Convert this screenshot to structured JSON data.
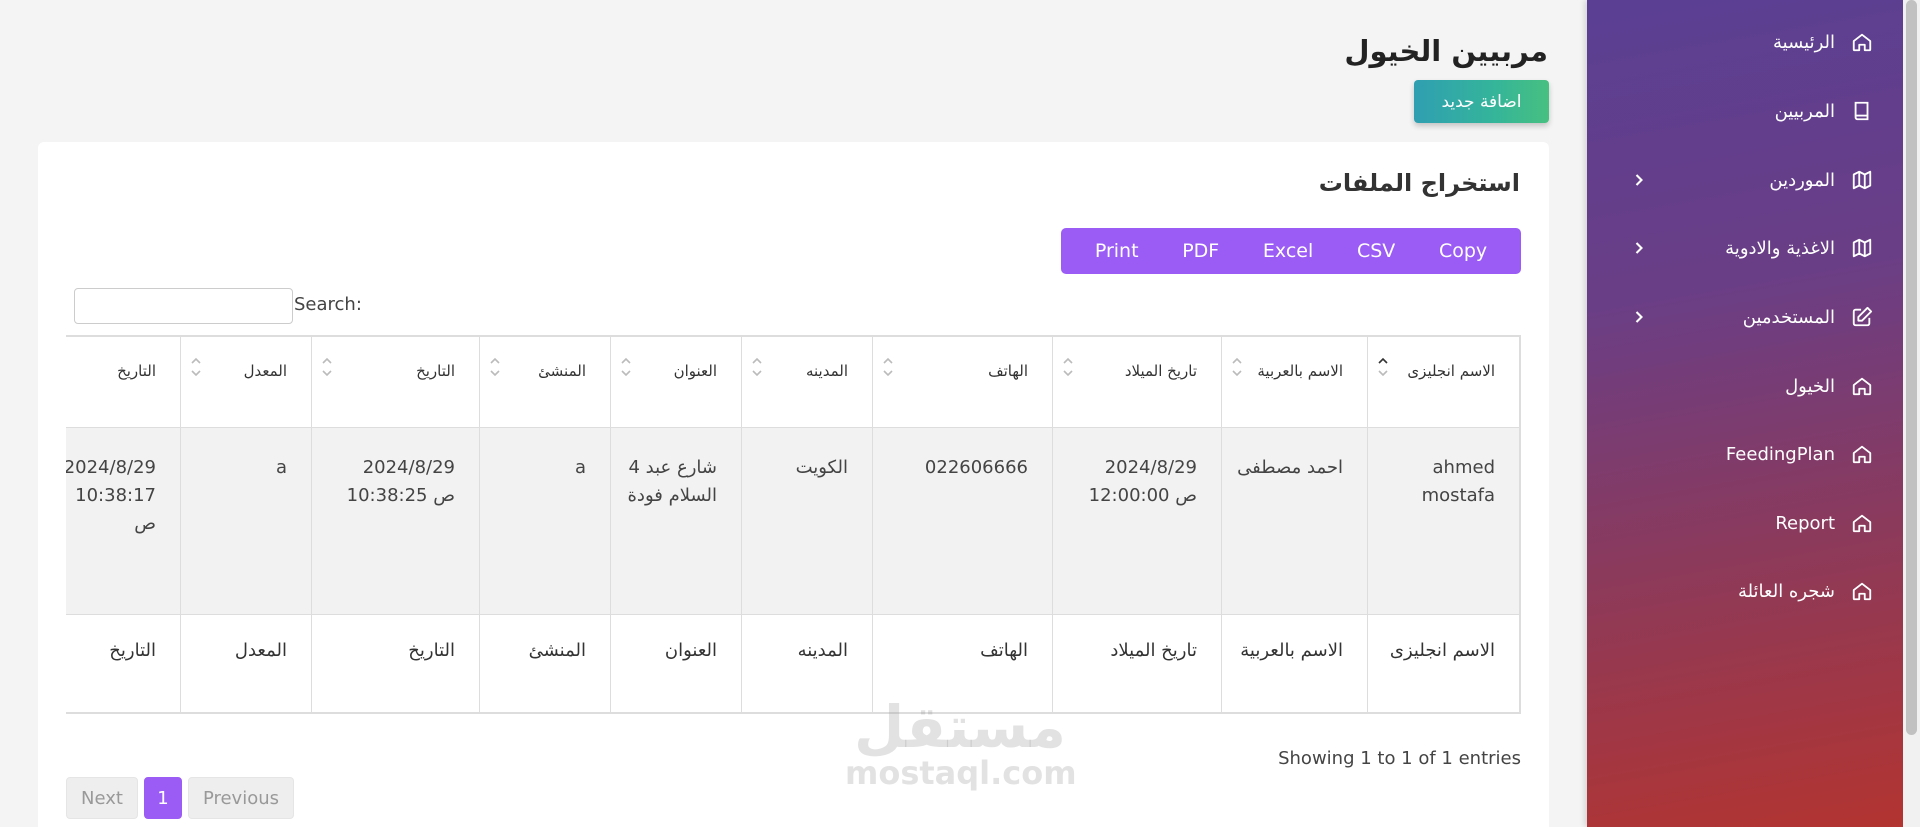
{
  "sidebar": {
    "items": [
      {
        "label": "الرئيسية",
        "icon": "home-icon",
        "has_submenu": false
      },
      {
        "label": "المربيين",
        "icon": "book-icon",
        "has_submenu": false
      },
      {
        "label": "الموردين",
        "icon": "map-icon",
        "has_submenu": true
      },
      {
        "label": "الاغذية والادوية",
        "icon": "map-icon",
        "has_submenu": true
      },
      {
        "label": "المستخدمين",
        "icon": "edit-icon",
        "has_submenu": true
      },
      {
        "label": "الخيول",
        "icon": "home-icon",
        "has_submenu": false
      },
      {
        "label": "FeedingPlan",
        "icon": "home-icon",
        "has_submenu": false
      },
      {
        "label": "Report",
        "icon": "home-icon",
        "has_submenu": false
      },
      {
        "label": "شجره العائلة",
        "icon": "home-icon",
        "has_submenu": false
      }
    ]
  },
  "header": {
    "title": "مربيين الخيول",
    "add_button": "اضافة جديد"
  },
  "card": {
    "title": "استخراج الملفات",
    "export_buttons": [
      "Copy",
      "CSV",
      "Excel",
      "PDF",
      "Print"
    ],
    "search_label": "Search:",
    "search_value": ""
  },
  "table": {
    "columns": [
      {
        "header": "الاسم انجليزى",
        "value": "ahmed mostafa"
      },
      {
        "header": "الاسم بالعربية",
        "value": "احمد مصطفى"
      },
      {
        "header": "تاريخ الميلاد",
        "value": "2024/8/29 12:00:00 ص"
      },
      {
        "header": "الهاتف",
        "value": "022606666"
      },
      {
        "header": "المدينه",
        "value": "الكويت"
      },
      {
        "header": "العنوان",
        "value": "4 شارع عبد السلام فودة"
      },
      {
        "header": "المنشئ",
        "value": "a"
      },
      {
        "header": "التاريخ",
        "value": "2024/8/29 10:38:25 ص"
      },
      {
        "header": "المعدل",
        "value": "a"
      },
      {
        "header": "التاريخ",
        "value": "2024/8/29 10:38:17 ص"
      }
    ],
    "footer": [
      "الاسم انجليزى",
      "الاسم بالعربية",
      "تاريخ الميلاد",
      "الهاتف",
      "المدينه",
      "العنوان",
      "المنشئ",
      "التاريخ",
      "المعدل",
      "التاريخ"
    ]
  },
  "pagination": {
    "info": "Showing 1 to 1 of 1 entries",
    "previous": "Previous",
    "page": "1",
    "next": "Next"
  },
  "watermark": {
    "arabic": "مستقل",
    "latin": "mostaql.com"
  },
  "colors": {
    "accent": "#9b5cf6",
    "sidebar_top": "#5a3f93",
    "sidebar_bottom": "#b33430",
    "add_button": "#35b59a"
  }
}
